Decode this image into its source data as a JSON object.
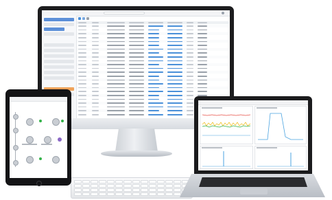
{
  "monitor_app": {
    "title": "",
    "search_placeholder": "",
    "sidebar_items": 16,
    "active_sidebar_index": 11,
    "table_rows": 24
  },
  "laptop_app": {
    "panels": 4
  },
  "colors": {
    "accent": "#4a90d9",
    "sidebar_active": "#f0a35a",
    "status_ok": "#33b249",
    "chart_red": "#e8534a",
    "chart_yellow": "#f2c230",
    "chart_green": "#33b249",
    "chart_blue": "#4aa3e0"
  }
}
